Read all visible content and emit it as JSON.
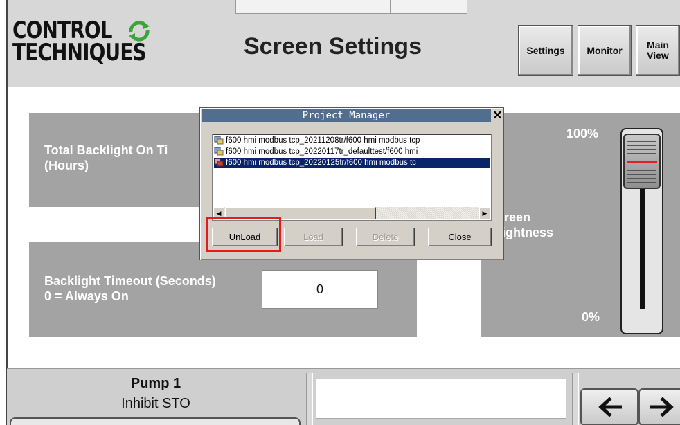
{
  "header": {
    "logo_line1": "CONTROL",
    "logo_line2": "TECHNIQUES",
    "title": "Screen Settings",
    "buttons": {
      "settings": "Settings",
      "monitor": "Monitor",
      "main_view": "Main\nView"
    }
  },
  "panels": {
    "hours_label": "Total Backlight On Ti\n(Hours)",
    "timeout_label": "Backlight Timeout (Seconds)\n0 = Always On",
    "timeout_value": "0",
    "brightness_max": "100%",
    "brightness_min": "0%",
    "brightness_label": "creen\nrightness",
    "brightness_level": 1.0
  },
  "dialog": {
    "title": "Project Manager",
    "close_glyph": "✕",
    "items": [
      {
        "text": "f600 hmi modbus tcp_20211208tr/f600 hmi modbus tcp",
        "selected": false
      },
      {
        "text": "f600 hmi modbus tcp_20220117tr_defaulttest/f600 hmi",
        "selected": false
      },
      {
        "text": "f600 hmi modbus tcp_20220125tr/f600 hmi modbus tc",
        "selected": true
      }
    ],
    "buttons": {
      "unload": "UnLoad",
      "load": "Load",
      "delete": "Delete",
      "close": "Close"
    }
  },
  "footer": {
    "pump_title": "Pump 1",
    "pump_status": "Inhibit STO"
  },
  "colors": {
    "header_bg": "#d7d7d7",
    "panel_bg": "#a3a3a3",
    "dialog_title_bg": "#526e8e",
    "selection_bg": "#0a246a",
    "highlight": "#e41b1b",
    "slider_marker": "#d22222"
  },
  "icons": [
    "logo-arrows-icon",
    "project-folder-icon",
    "close-icon",
    "arrow-left-icon",
    "arrow-right-icon",
    "scroll-left-icon",
    "scroll-right-icon"
  ]
}
